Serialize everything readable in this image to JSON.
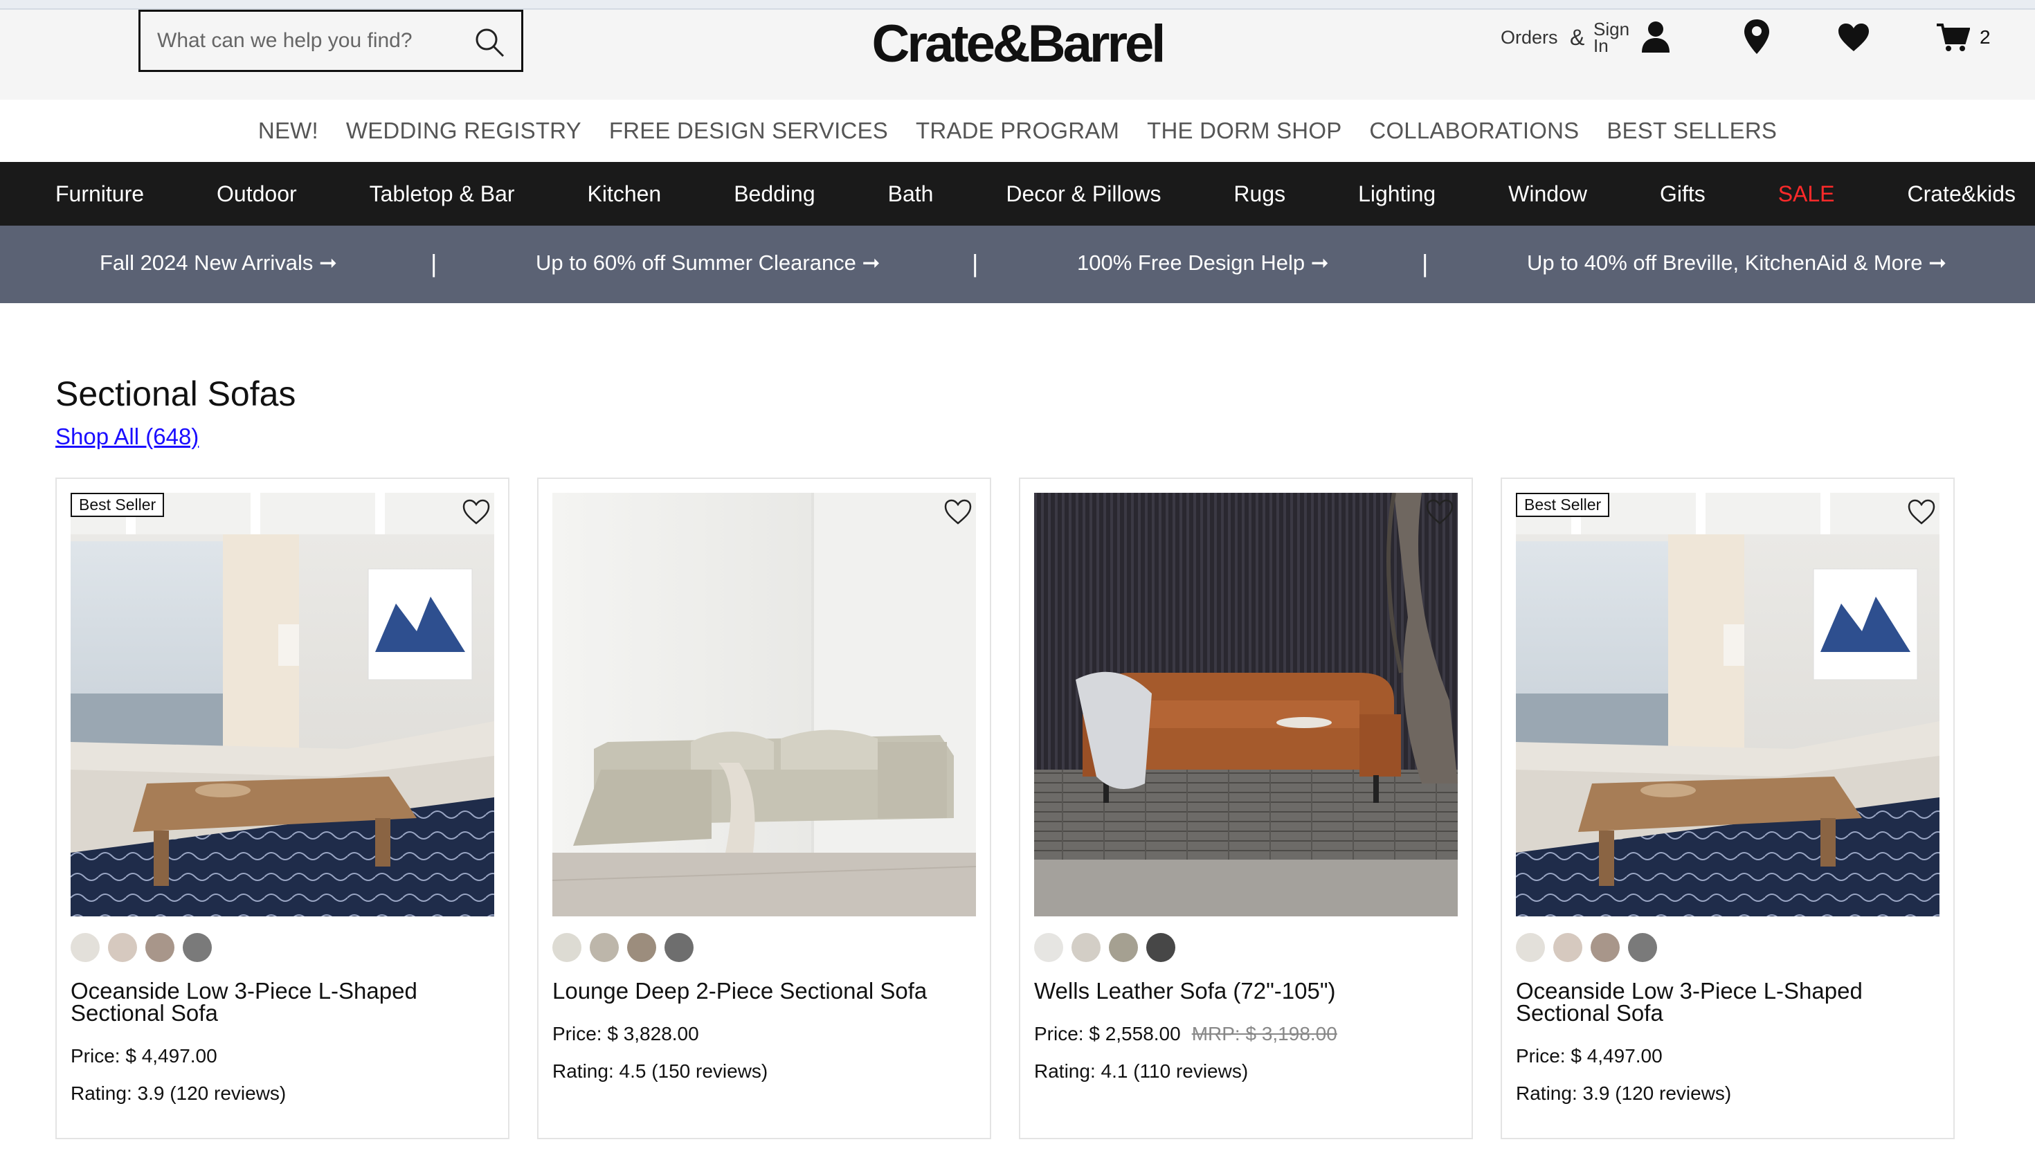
{
  "header": {
    "search_placeholder": "What can we help you find?",
    "logo": "Crate&Barrel",
    "orders_label": "Orders",
    "amp": "&",
    "signin_label": "Sign In",
    "cart_count": "2"
  },
  "secondary_nav": [
    "NEW!",
    "WEDDING REGISTRY",
    "FREE DESIGN SERVICES",
    "TRADE PROGRAM",
    "THE DORM SHOP",
    "COLLABORATIONS",
    "BEST SELLERS"
  ],
  "main_nav": [
    "Furniture",
    "Outdoor",
    "Tabletop & Bar",
    "Kitchen",
    "Bedding",
    "Bath",
    "Decor & Pillows",
    "Rugs",
    "Lighting",
    "Window",
    "Gifts",
    "SALE",
    "Crate&kids"
  ],
  "promos": [
    "Fall 2024 New Arrivals ➞",
    "Up to 60% off Summer Clearance ➞",
    "100% Free Design Help ➞",
    "Up to 40% off Breville, KitchenAid & More ➞"
  ],
  "promo_separator": "|",
  "section": {
    "title": "Sectional Sofas",
    "shop_all": "Shop All (648)"
  },
  "products": [
    {
      "badge": "Best Seller",
      "name": "Oceanside Low 3-Piece L-Shaped Sectional Sofa",
      "price": "Price: $ 4,497.00",
      "mrp": "",
      "rating": "Rating: 3.9 (120 reviews)",
      "swatches": [
        "#e3e0da",
        "#d6c9bf",
        "#a8968a",
        "#7a7a7a"
      ]
    },
    {
      "badge": "",
      "name": "Lounge Deep 2-Piece Sectional Sofa",
      "price": "Price: $ 3,828.00",
      "mrp": "",
      "rating": "Rating: 4.5 (150 reviews)",
      "swatches": [
        "#dddbd3",
        "#bdb6aa",
        "#9c8d7d",
        "#6e6e6e"
      ]
    },
    {
      "badge": "",
      "name": "Wells Leather Sofa (72\"-105\")",
      "price": "Price: $ 2,558.00",
      "mrp": "MRP: $ 3,198.00",
      "rating": "Rating: 4.1 (110 reviews)",
      "swatches": [
        "#e6e5e2",
        "#d3cec6",
        "#a5a091",
        "#474747"
      ]
    },
    {
      "badge": "Best Seller",
      "name": "Oceanside Low 3-Piece L-Shaped Sectional Sofa",
      "price": "Price: $ 4,497.00",
      "mrp": "",
      "rating": "Rating: 3.9 (120 reviews)",
      "swatches": [
        "#e3e0da",
        "#d6c9bf",
        "#a8968a",
        "#7a7a7a"
      ]
    }
  ],
  "colors": {
    "main_nav_bg": "#1a1a1a",
    "promo_bg": "#5b6274",
    "sale_red": "#ff2a2a",
    "link_blue": "#1a0dff"
  },
  "icons": [
    "search-icon",
    "account-icon",
    "location-pin-icon",
    "heart-icon",
    "cart-icon",
    "wishlist-heart-icon"
  ]
}
